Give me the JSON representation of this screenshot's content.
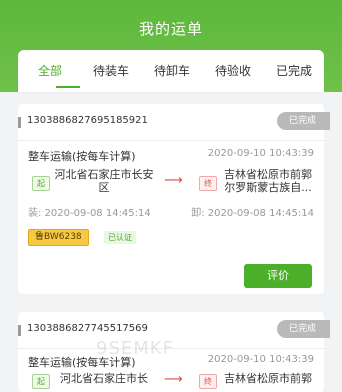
{
  "header": {
    "title": "我的运单"
  },
  "tabs": [
    {
      "label": "全部",
      "active": true
    },
    {
      "label": "待装车",
      "active": false
    },
    {
      "label": "待卸车",
      "active": false
    },
    {
      "label": "待验收",
      "active": false
    },
    {
      "label": "已完成",
      "active": false
    }
  ],
  "orders": [
    {
      "order_no": "1303886827695185921",
      "status": "已完成",
      "biz_type": "整车运输(按每车计算)",
      "biz_time": "2020-09-10 10:43:39",
      "from_tag": "起",
      "from_addr": "河北省石家庄市长安区",
      "to_tag": "终",
      "to_addr": "吉林省松原市前郭尔罗斯蒙古族自...",
      "load_time": "装: 2020-09-08 14:45:14",
      "unload_time": "卸: 2020-09-08 14:45:14",
      "plate": "鲁BW6238",
      "verified": "已认证",
      "action": "评价"
    },
    {
      "order_no": "1303886827745517569",
      "status": "已完成",
      "biz_type": "整车运输(按每车计算)",
      "biz_time": "2020-09-10 10:43:39",
      "from_tag": "起",
      "from_addr": "河北省石家庄市长",
      "to_tag": "终",
      "to_addr": "吉林省松原市前郭"
    }
  ],
  "watermark": "9SEMKF",
  "colors": {
    "brand_green": "#4caf2a",
    "status_gray": "#b9b9b9",
    "plate_yellow": "#f7c844",
    "arrow_red": "#e0474a"
  }
}
